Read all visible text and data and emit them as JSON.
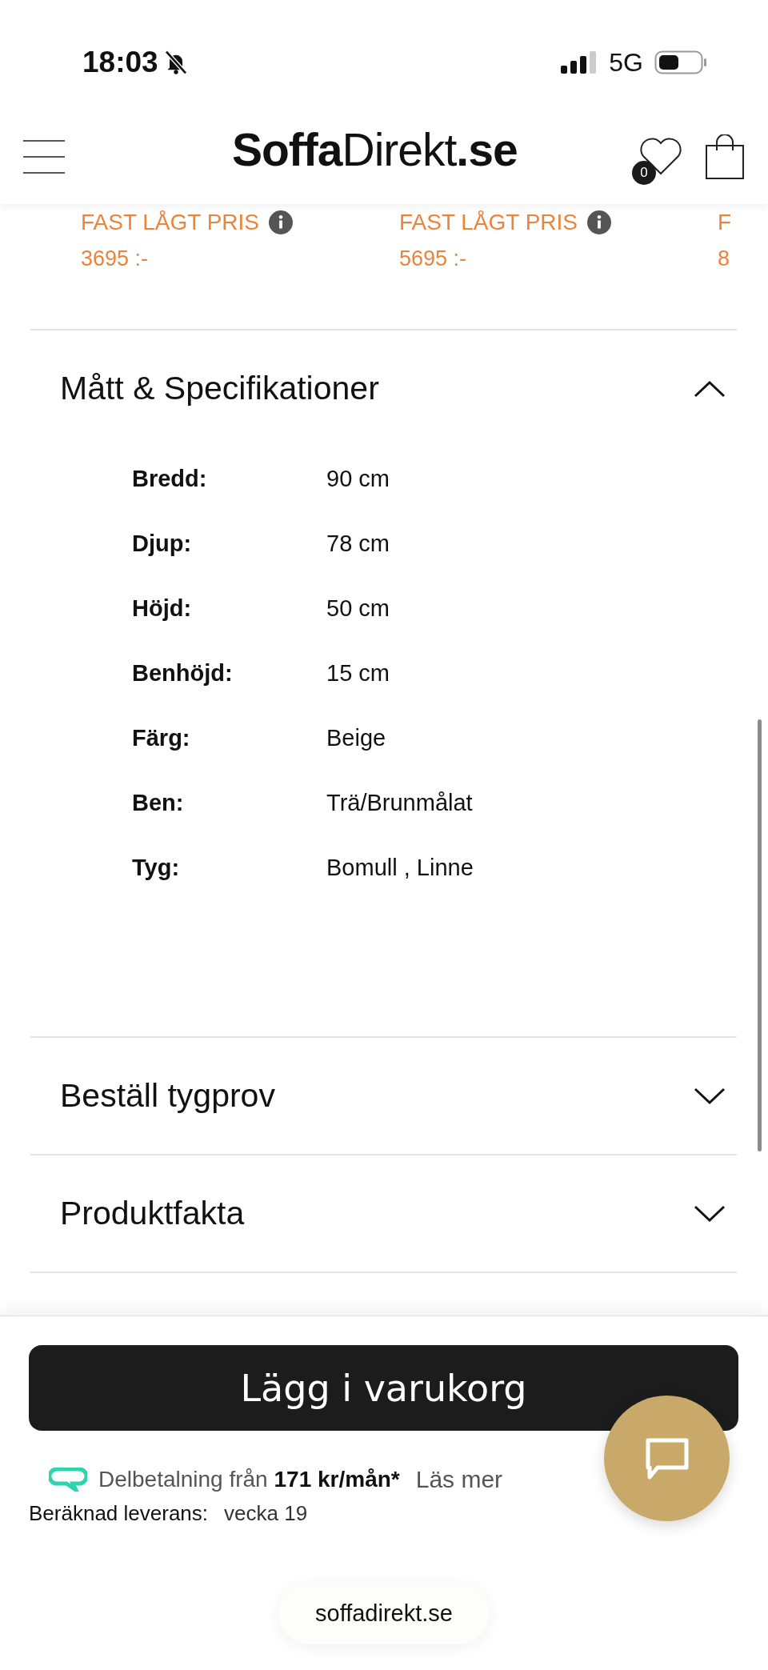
{
  "status_bar": {
    "time": "18:03",
    "network": "5G"
  },
  "header": {
    "logo": {
      "part_1": "Soffa",
      "part_2": "Direkt",
      "part_3": ".se"
    },
    "wishlist_count": "0"
  },
  "related_products": [
    {
      "badge": "FAST LÅGT PRIS",
      "info_icon": true,
      "price": "3695 :-"
    },
    {
      "badge": "FAST LÅGT PRIS",
      "info_icon": true,
      "price": "5695 :-"
    },
    {
      "badge": "F",
      "price": "8"
    }
  ],
  "accordions": [
    {
      "title": "Mått & Specifikationer",
      "expanded": true,
      "specs": [
        {
          "label": "Bredd:",
          "value": "90 cm"
        },
        {
          "label": "Djup:",
          "value": "78 cm"
        },
        {
          "label": "Höjd:",
          "value": "50 cm"
        },
        {
          "label": "Benhöjd:",
          "value": "15 cm"
        },
        {
          "label": "Färg:",
          "value": "Beige"
        },
        {
          "label": "Ben:",
          "value": "Trä/Brunmålat"
        },
        {
          "label": "Tyg:",
          "value": "Bomull , Linne"
        }
      ]
    },
    {
      "title": "Beställ tygprov",
      "expanded": false
    },
    {
      "title": "Produktfakta",
      "expanded": false
    }
  ],
  "cart_button": "Lägg i varukorg",
  "installment": {
    "prefix": "Delbetalning från",
    "amount": "171 kr/mån*",
    "link": "Läs mer"
  },
  "delivery": {
    "label": "Beräknad leverans:",
    "value": "vecka 19"
  },
  "browser": {
    "url": "soffadirekt.se"
  }
}
